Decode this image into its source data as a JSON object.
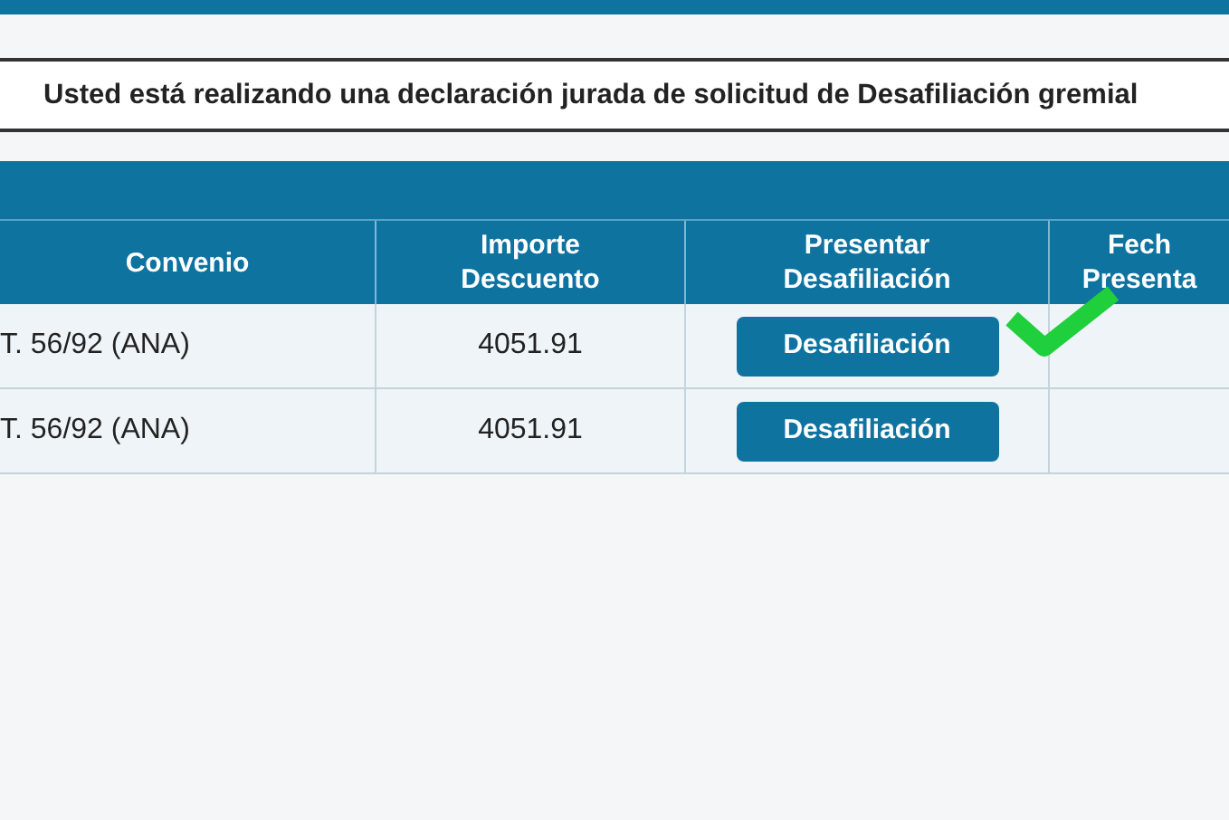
{
  "notice": "Usted está realizando una declaración jurada de solicitud de Desafiliación gremial",
  "table": {
    "columns": [
      "Convenio",
      "Importe\nDescuento",
      "Presentar\nDesafiliación",
      "Fech\nPresenta"
    ],
    "rows": [
      {
        "convenio": "T. 56/92 (ANA)",
        "importe": "4051.91",
        "button": "Desafiliación",
        "checked": true
      },
      {
        "convenio": "T. 56/92 (ANA)",
        "importe": "4051.91",
        "button": "Desafiliación",
        "checked": false
      }
    ]
  }
}
